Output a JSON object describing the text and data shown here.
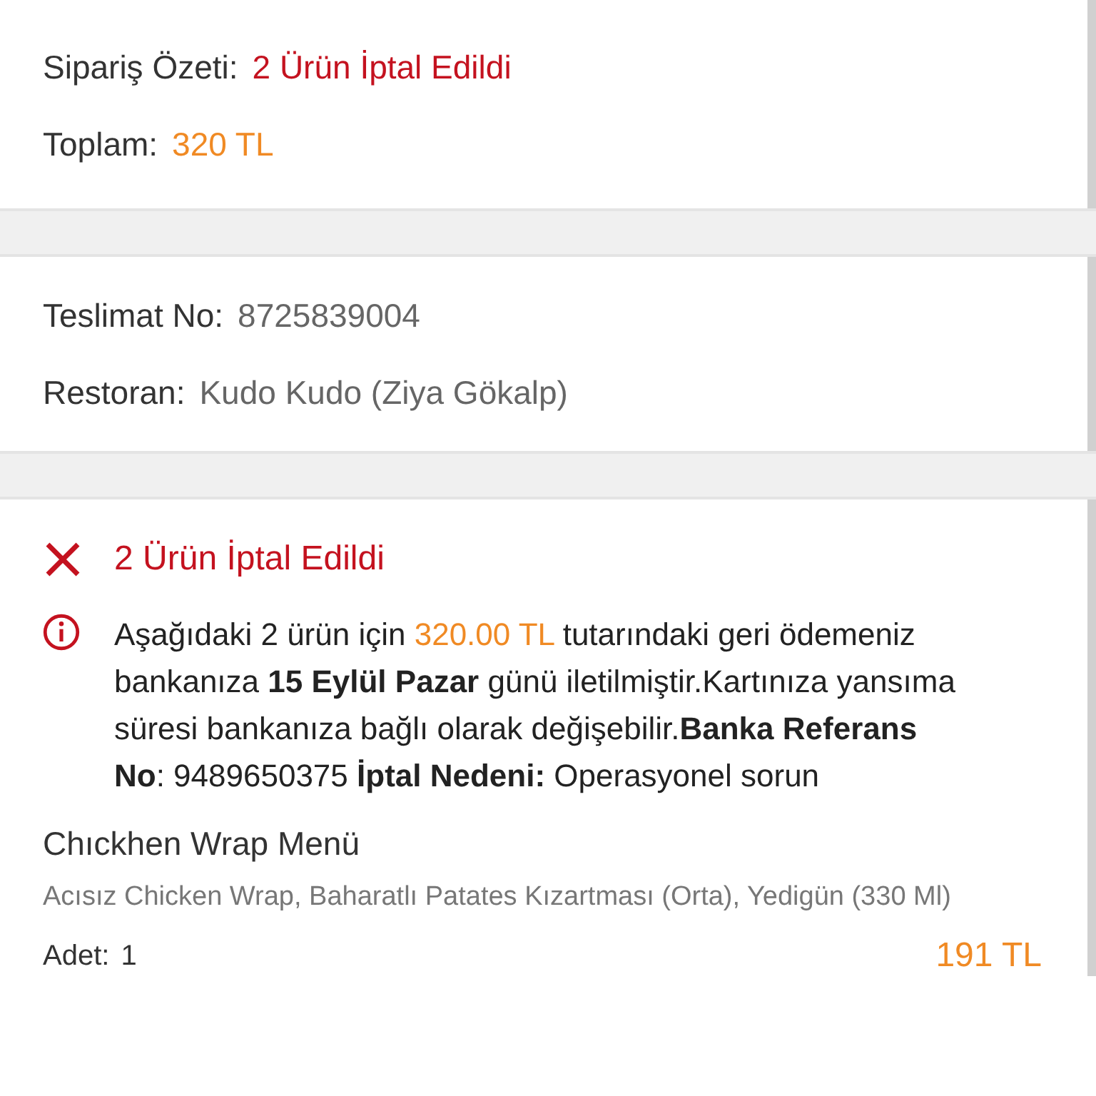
{
  "order_summary": {
    "rows": [
      {
        "kind": "alert",
        "label": "Sipariş Özeti:",
        "value": "2 Ürün İptal Edildi"
      },
      {
        "kind": "price",
        "label": "Toplam:",
        "value": "320 TL"
      }
    ]
  },
  "delivery": {
    "rows": [
      {
        "kind": "plain",
        "label": "Teslimat No:",
        "value": "8725839004"
      },
      {
        "kind": "plain",
        "label": "Restoran:",
        "value": "Kudo Kudo (Ziya Gökalp)"
      }
    ]
  },
  "cancellation": {
    "title": "2 Ürün İptal Edildi",
    "notice": {
      "before": "Aşağıdaki 2 ürün için ",
      "amount": "320.00 TL",
      "after": " tutarındaki geri ödemeniz bankanıza **15 Eylül Pazar** günü iletilmiştir.Kartınıza yansıma süresi bankanıza bağlı olarak değişebilir.**Banka Referans No**: 9489650375 **İptal Nedeni:** Operasyonel sorun"
    },
    "items": [
      {
        "name": "Chıckhen Wrap Menü",
        "details": "Acısız Chicken Wrap, Baharatlı Patates Kızartması (Orta), Yedigün (330 Ml)",
        "quantity_label": "Adet:",
        "quantity": "1",
        "price": "191 TL"
      }
    ]
  }
}
